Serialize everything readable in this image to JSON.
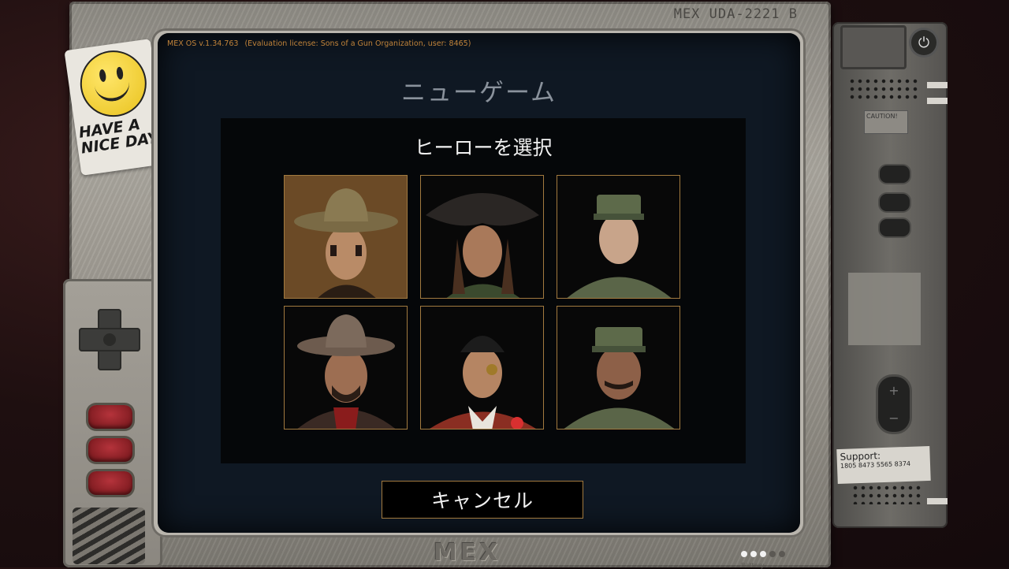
{
  "device": {
    "model": "MEX UDA-2221 B",
    "logo": "MEX",
    "sticker_text": "HAVE A NICE DAY",
    "battery_label": "Battery",
    "battery": {
      "filled": 3,
      "total": 5
    },
    "support_title": "Support:",
    "support_number": "1805 8473 5565 8374",
    "caution_text": "CAUTION!"
  },
  "os": {
    "version": "MEX OS v.1.34.763",
    "license": "(Evaluation license: Sons of a Gun Organization, user: 8465)"
  },
  "screen": {
    "title": "ニューゲーム",
    "panel_title": "ヒーローを選択",
    "cancel_label": "キャンセル"
  },
  "colors": {
    "accent_border": "#a27a3f",
    "os_text": "#c0833a",
    "screen_bg": "#0f1823",
    "panel_bg": "#050709",
    "button_red": "#b5333b"
  },
  "heroes": [
    {
      "id": "hero-cowgirl",
      "hat": "cowboy-hat",
      "bg": "#6b4a26"
    },
    {
      "id": "hero-pirate-woman",
      "hat": "tricorn-hat",
      "bg": "#080808"
    },
    {
      "id": "hero-soldier-woman",
      "hat": "military-cap",
      "bg": "#080808"
    },
    {
      "id": "hero-cowboy",
      "hat": "cowboy-hat",
      "bg": "#080808"
    },
    {
      "id": "hero-pirate-man",
      "hat": "bandana",
      "bg": "#080808"
    },
    {
      "id": "hero-soldier-man",
      "hat": "military-cap",
      "bg": "#080808"
    }
  ]
}
